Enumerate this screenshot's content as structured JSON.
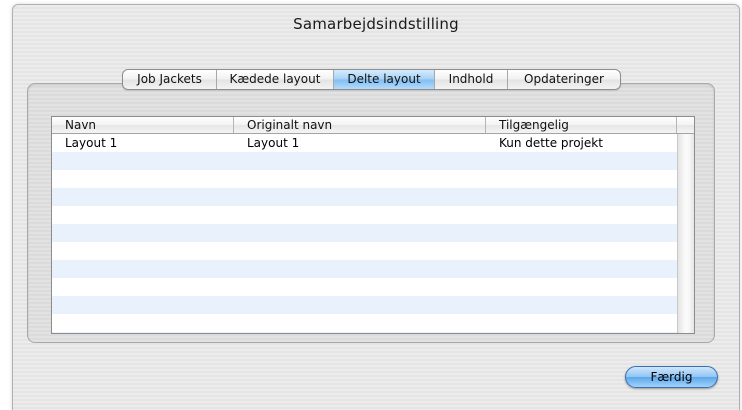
{
  "window": {
    "title": "Samarbejdsindstilling"
  },
  "tabs": [
    {
      "label": "Job Jackets"
    },
    {
      "label": "Kædede layout"
    },
    {
      "label": "Delte layout",
      "selected": true
    },
    {
      "label": "Indhold"
    },
    {
      "label": "Opdateringer"
    }
  ],
  "table": {
    "columns": [
      "Navn",
      "Originalt navn",
      "Tilgængelig"
    ],
    "rows": [
      [
        "Layout 1",
        "Layout 1",
        "Kun dette projekt"
      ]
    ]
  },
  "buttons": {
    "done_label": "Færdig"
  },
  "colors": {
    "selected_tab": "#80bdf2",
    "alternate_row": "#e9f1fd",
    "default_button": "#5ea6ea"
  }
}
